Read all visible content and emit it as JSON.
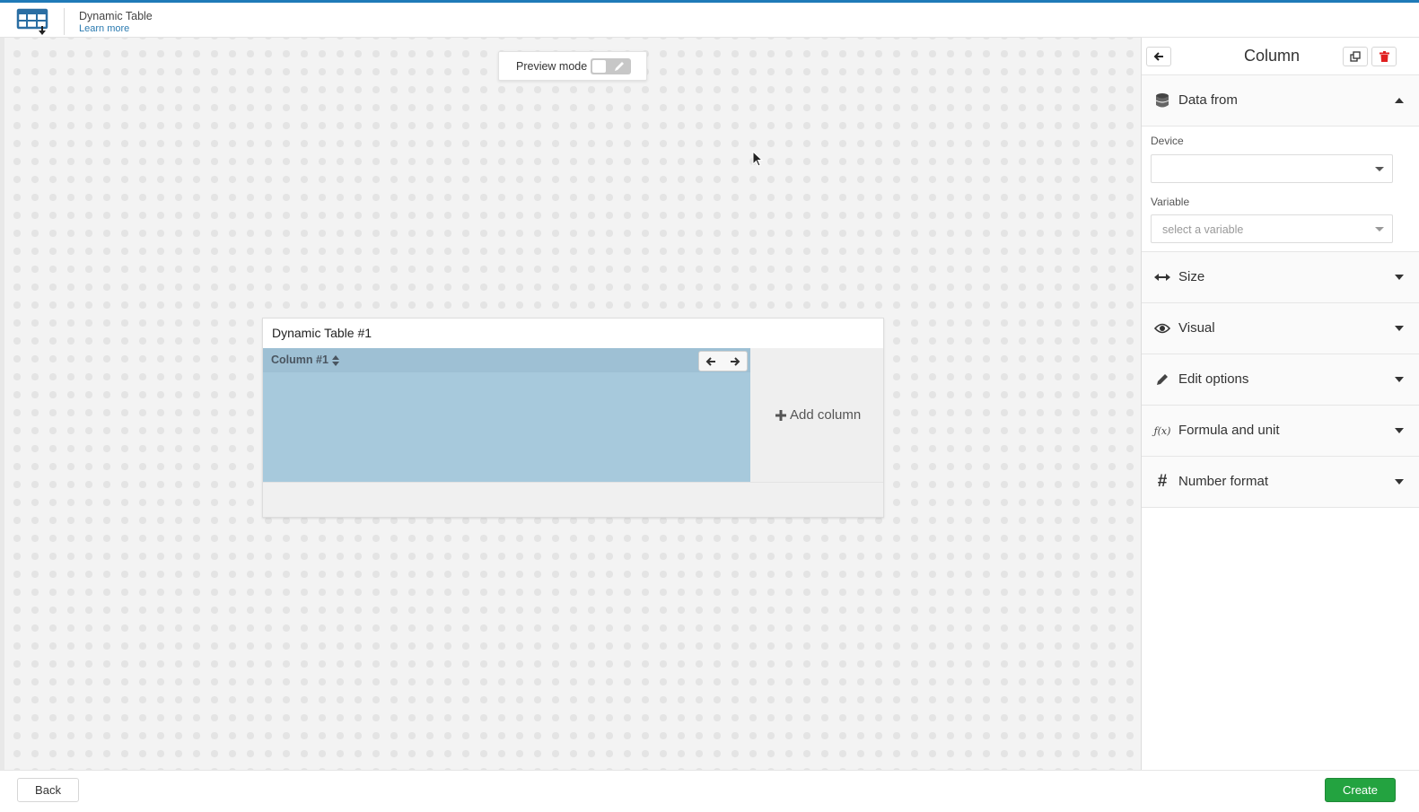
{
  "header": {
    "app_title": "Dynamic Table",
    "learn_more": "Learn more",
    "app_icon": "table-download-icon"
  },
  "canvas": {
    "preview_mode_label": "Preview mode",
    "preview_mode_on": false
  },
  "widget": {
    "title": "Dynamic Table #1",
    "columns": [
      {
        "label": "Column #1"
      }
    ],
    "add_column_label": "Add column"
  },
  "panel": {
    "title": "Column",
    "sections": [
      {
        "label": "Data from",
        "icon": "database-icon",
        "expanded": true
      },
      {
        "label": "Size",
        "icon": "arrows-horizontal-icon",
        "expanded": false
      },
      {
        "label": "Visual",
        "icon": "eye-icon",
        "expanded": false
      },
      {
        "label": "Edit options",
        "icon": "pencil-icon",
        "expanded": false
      },
      {
        "label": "Formula and unit",
        "icon": "function-icon",
        "expanded": false
      },
      {
        "label": "Number format",
        "icon": "hashtag-icon",
        "expanded": false
      }
    ],
    "data_from": {
      "device_label": "Device",
      "device_value": "",
      "variable_label": "Variable",
      "variable_placeholder": "select a variable"
    },
    "function_glyph": "ƒ(x)",
    "hash_glyph": "#"
  },
  "footer": {
    "back_label": "Back",
    "create_label": "Create"
  },
  "colors": {
    "accent": "#1f7ab8",
    "column_fill": "#a7c9dc",
    "create_green": "#23a340",
    "delete_red": "#e02020"
  }
}
